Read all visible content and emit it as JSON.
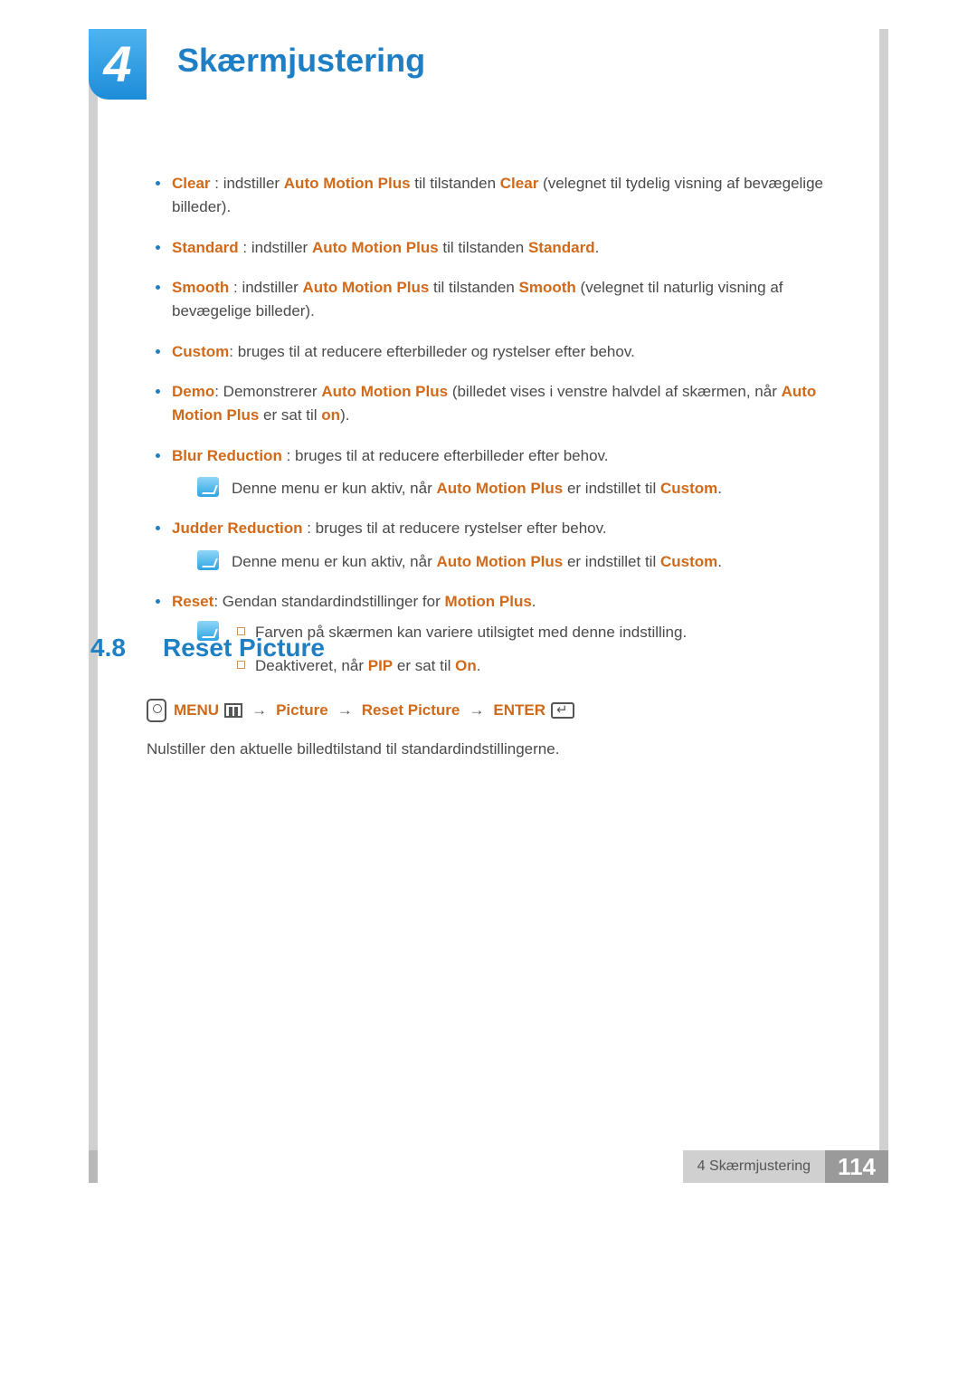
{
  "chapter": {
    "number": "4",
    "title": "Skærmjustering"
  },
  "list": {
    "clear": {
      "pre": "Clear",
      "mid1": " : indstiller ",
      "amp": "Auto Motion Plus",
      "mid2": " til tilstanden ",
      "val": "Clear",
      "post": " (velegnet til tydelig visning af bevægelige billeder)."
    },
    "standard": {
      "pre": "Standard",
      "mid1": " : indstiller ",
      "amp": "Auto Motion Plus",
      "mid2": " til tilstanden ",
      "val": "Standard",
      "post": "."
    },
    "smooth": {
      "pre": "Smooth",
      "mid1": " : indstiller ",
      "amp": "Auto Motion Plus",
      "mid2": " til tilstanden ",
      "val": "Smooth",
      "post": " (velegnet til naturlig visning af bevægelige billeder)."
    },
    "custom": {
      "pre": "Custom",
      "post": ": bruges til at reducere efterbilleder og rystelser efter behov."
    },
    "demo": {
      "pre": "Demo",
      "mid1": ": Demonstrerer ",
      "amp": "Auto Motion Plus",
      "mid2": " (billedet vises i venstre halvdel af skærmen, når ",
      "amp2": "Auto Motion Plus",
      "mid3": " er sat til ",
      "on": "on",
      "post": ")."
    },
    "blur": {
      "pre": "Blur Reduction",
      "post": " : bruges til at reducere efterbilleder efter behov."
    },
    "note1": {
      "t1": "Denne menu er kun aktiv, når ",
      "amp": "Auto Motion Plus",
      "t2": " er indstillet til ",
      "val": "Custom",
      "t3": "."
    },
    "judder": {
      "pre": "Judder Reduction",
      "post": " : bruges til at reducere rystelser efter behov."
    },
    "note2": {
      "t1": "Denne menu er kun aktiv, når ",
      "amp": "Auto Motion Plus",
      "t2": " er indstillet til ",
      "val": "Custom",
      "t3": "."
    },
    "reset": {
      "pre": "Reset",
      "mid": ": Gendan standardindstillinger for ",
      "val": "Motion Plus",
      "post": "."
    },
    "sub1": "Farven på skærmen kan variere utilsigtet med denne indstilling.",
    "sub2": {
      "t1": "Deaktiveret, når ",
      "pip": "PIP",
      "t2": " er sat til ",
      "on": "On",
      "t3": "."
    }
  },
  "section": {
    "num": "4.8",
    "title": "Reset Picture"
  },
  "nav": {
    "menu": "MENU",
    "picture": "Picture",
    "reset": "Reset Picture",
    "enter": "ENTER",
    "arrow": "→"
  },
  "body": "Nulstiller den aktuelle billedtilstand til standardindstillingerne.",
  "footer": {
    "label": "4 Skærmjustering",
    "page": "114"
  }
}
